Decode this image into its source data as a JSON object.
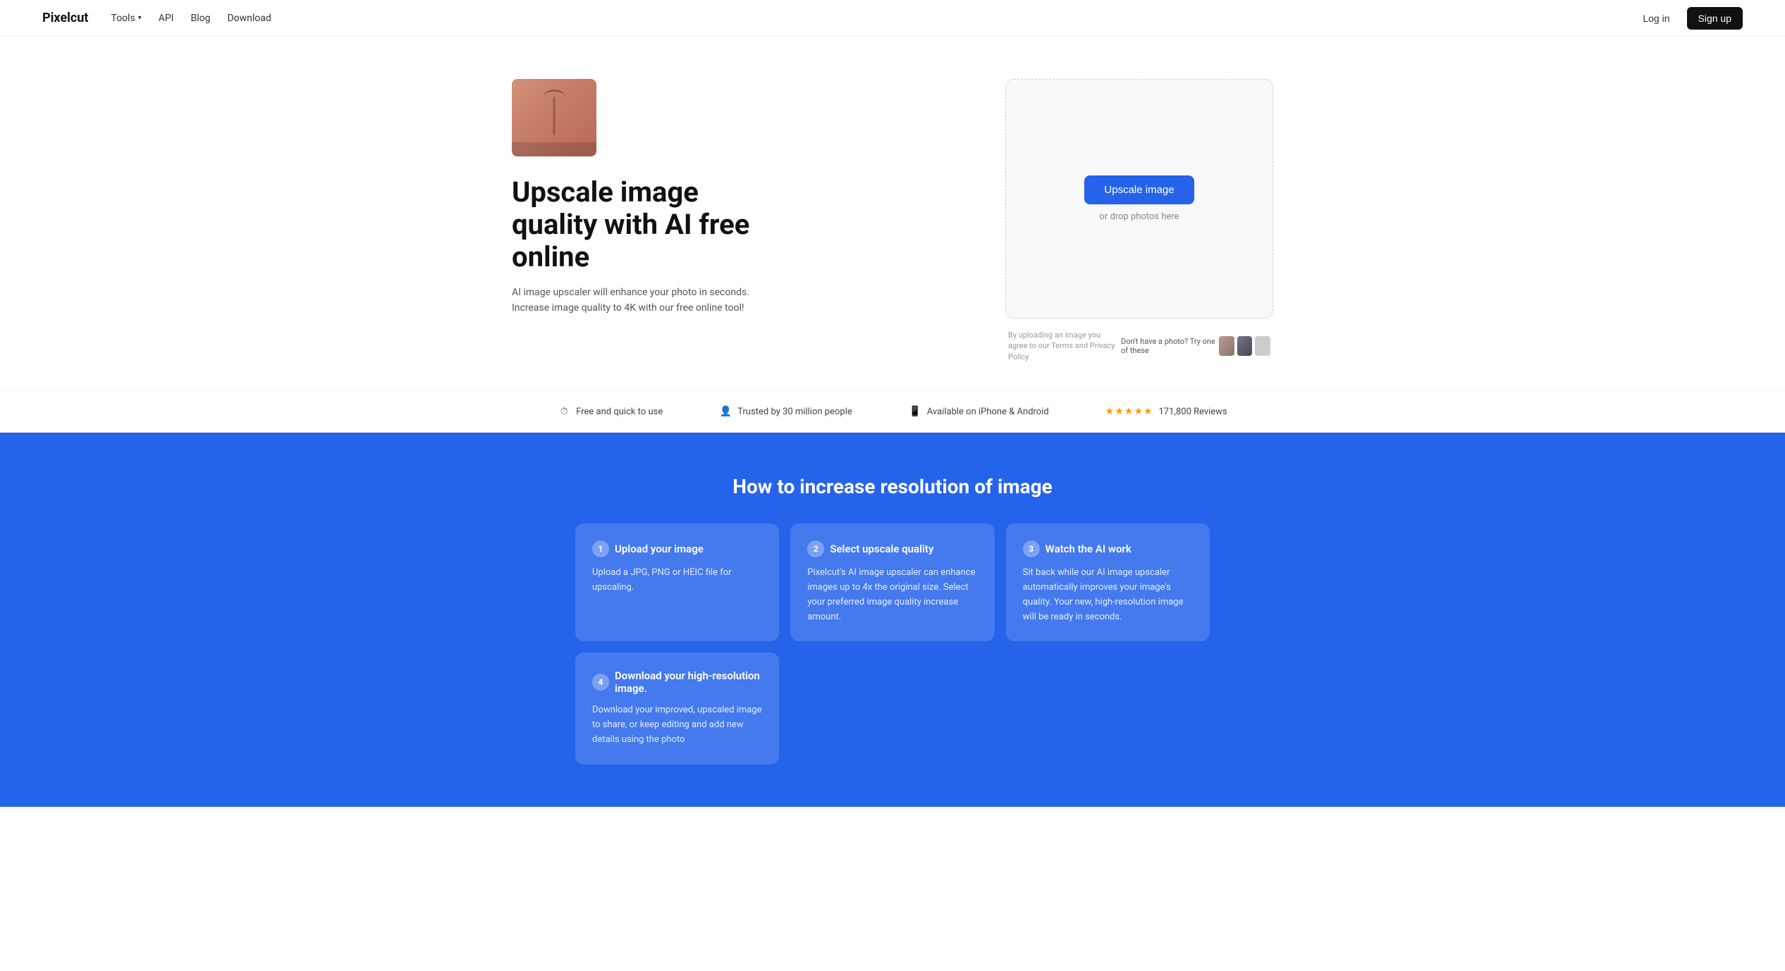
{
  "navbar": {
    "logo": "Pixelcut",
    "links": [
      {
        "label": "Tools",
        "hasDropdown": true
      },
      {
        "label": "API"
      },
      {
        "label": "Blog"
      },
      {
        "label": "Download"
      }
    ],
    "login_label": "Log in",
    "signup_label": "Sign up"
  },
  "hero": {
    "title": "Upscale image quality with AI free online",
    "description": "AI image upscaler will enhance your photo in seconds. Increase image quality to 4K with our free online tool!",
    "upload_button": "Upscale image",
    "drop_text": "or drop photos here",
    "terms_text": "By uploading an image you agree to our Terms and Privacy Policy",
    "samples_label": "Don't have a photo? Try one of these"
  },
  "trust_bar": [
    {
      "icon": "⏱",
      "text": "Free and quick to use"
    },
    {
      "icon": "👤",
      "text": "Trusted by 30 million people"
    },
    {
      "icon": "📱",
      "text": "Available on iPhone & Android"
    },
    {
      "stars": "★★★★★",
      "reviews_count": "171,800 Reviews"
    }
  ],
  "howto": {
    "title": "How to increase resolution of image",
    "cards": [
      {
        "step": "1",
        "title": "Upload your image",
        "description": "Upload a JPG, PNG or HEIC file for upscaling."
      },
      {
        "step": "2",
        "title": "Select upscale quality",
        "description": "Pixelcut's AI image upscaler can enhance images up to 4x the original size. Select your preferred image quality increase amount."
      },
      {
        "step": "3",
        "title": "Watch the AI work",
        "description": "Sit back while our AI image upscaler automatically improves your image's quality. Your new, high-resolution image will be ready in seconds."
      },
      {
        "step": "4",
        "title": "Download your high-resolution image.",
        "description": "Download your improved, upscaled image to share, or keep editing and add new details using the photo"
      }
    ]
  }
}
